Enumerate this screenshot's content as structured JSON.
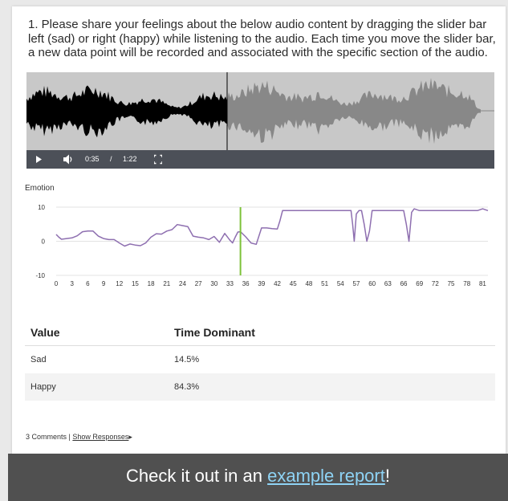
{
  "question": {
    "text": "1. Please share your feelings about the below audio content by dragging the slider bar left (sad) or right (happy) while listening to the audio. Each time you move the slider bar, a new data point will be recorded and associated with the specific section of the audio."
  },
  "player": {
    "current_time": "0:35",
    "separator": "/",
    "duration": "1:22",
    "played_color": "#000000",
    "unplayed_color": "#888888",
    "background_color": "#c8c8c8",
    "controls_color": "#4c5058",
    "icons": [
      "play-icon",
      "volume-icon",
      "fullscreen-icon"
    ]
  },
  "chart": {
    "label": "Emotion"
  },
  "chart_data": {
    "type": "line",
    "title": "",
    "ylabel": "Emotion",
    "xlabel": "",
    "ylim": [
      -10,
      10
    ],
    "yticks": [
      "10",
      "0",
      "-10"
    ],
    "xticks": [
      "0",
      "3",
      "6",
      "9",
      "12",
      "15",
      "18",
      "21",
      "24",
      "27",
      "30",
      "33",
      "36",
      "39",
      "42",
      "45",
      "48",
      "51",
      "54",
      "57",
      "60",
      "63",
      "66",
      "69",
      "72",
      "75",
      "78",
      "81"
    ],
    "xlim": [
      0,
      82
    ],
    "line_color": "#8e6fb0",
    "marker_color": "#7dc23a",
    "marker_x": 35,
    "series": [
      {
        "x": [
          0,
          0.5,
          1,
          2,
          3,
          4,
          5,
          6,
          7,
          8,
          9,
          10,
          11,
          12,
          13,
          14,
          15,
          16,
          17,
          18,
          19,
          20,
          21,
          22,
          23,
          24,
          25,
          26,
          27,
          28,
          29,
          30,
          31,
          32,
          33,
          33.5,
          34,
          34.5,
          35,
          36,
          37,
          38,
          39,
          40,
          41,
          42,
          42.5,
          43,
          44,
          45,
          50,
          55,
          56,
          56.3,
          56.6,
          57,
          57.5,
          58,
          58.5,
          59,
          59.5,
          60,
          61,
          62,
          63,
          64,
          65,
          66,
          66.5,
          67,
          67.5,
          68,
          69,
          70,
          75,
          80,
          81,
          82
        ],
        "y": [
          2,
          1.2,
          0.6,
          0.8,
          1,
          1.6,
          2.8,
          3,
          3,
          1.5,
          0.8,
          0.5,
          0.5,
          -0.5,
          -1.4,
          -0.8,
          -1.1,
          -1.3,
          -0.5,
          1.2,
          2.2,
          2.1,
          3,
          3.4,
          4.9,
          4.6,
          4.3,
          1.5,
          1.2,
          1,
          0.5,
          1.4,
          -0.3,
          2.3,
          0.3,
          -0.5,
          1.2,
          2.7,
          2.8,
          1.3,
          -0.5,
          -0.9,
          3.9,
          3.9,
          3.7,
          3.6,
          6,
          9,
          9,
          9,
          9,
          9,
          9,
          5,
          0,
          8,
          9,
          9,
          5,
          0,
          3,
          9,
          9,
          9,
          9,
          9,
          9,
          9,
          5,
          0,
          8.5,
          9.5,
          9,
          9,
          9,
          9,
          9.5,
          9
        ]
      }
    ]
  },
  "table": {
    "headers": [
      "Value",
      "Time Dominant"
    ],
    "rows": [
      [
        "Sad",
        "14.5%"
      ],
      [
        "Happy",
        "84.3%"
      ]
    ]
  },
  "footer": {
    "comments": "3 Comments |",
    "show_responses": "Show Responses",
    "arrow": "▸"
  },
  "banner": {
    "prefix": "Check it out in an ",
    "link": "example report",
    "suffix": "!"
  }
}
